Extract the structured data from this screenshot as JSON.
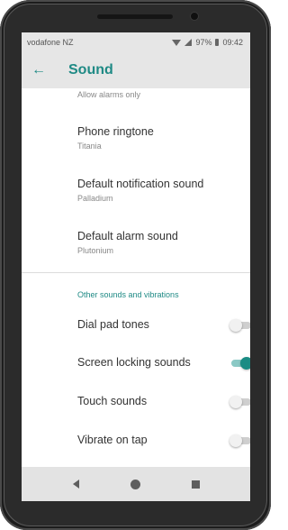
{
  "status_bar": {
    "carrier": "vodafone NZ",
    "battery": "97%",
    "time": "09:42"
  },
  "app_bar": {
    "title": "Sound",
    "back_icon": "arrow-left-icon"
  },
  "partial_item": "Allow alarms only",
  "settings": [
    {
      "title": "Phone ringtone",
      "subtitle": "Titania"
    },
    {
      "title": "Default notification sound",
      "subtitle": "Palladium"
    },
    {
      "title": "Default alarm sound",
      "subtitle": "Plutonium"
    }
  ],
  "section_header": "Other sounds and vibrations",
  "toggles": [
    {
      "label": "Dial pad tones",
      "on": false
    },
    {
      "label": "Screen locking sounds",
      "on": true
    },
    {
      "label": "Touch sounds",
      "on": false
    },
    {
      "label": "Vibrate on tap",
      "on": false
    }
  ],
  "colors": {
    "accent": "#1f8a85",
    "header_bg": "#e6e6e6"
  }
}
